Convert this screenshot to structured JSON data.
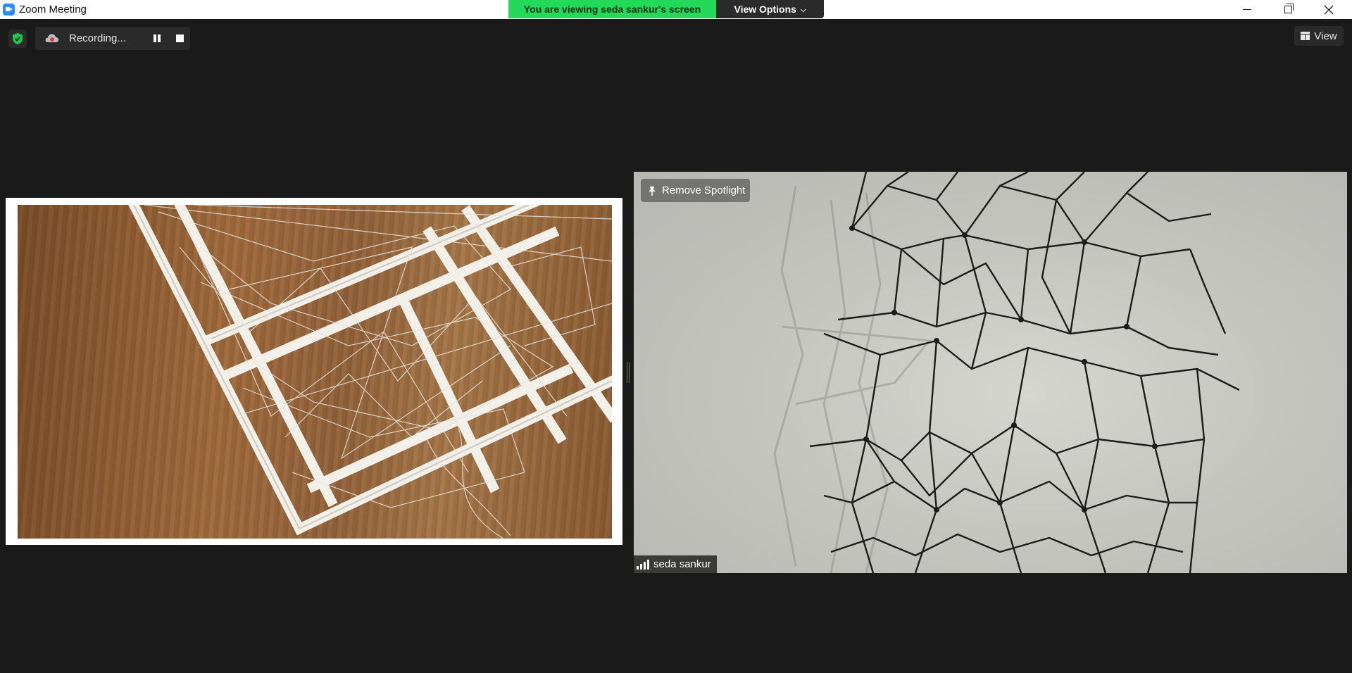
{
  "window": {
    "title": "Zoom Meeting"
  },
  "share_banner": {
    "viewing_text": "You are viewing seda sankur's screen",
    "view_options_label": "View Options"
  },
  "recording": {
    "status_text": "Recording..."
  },
  "view_button": {
    "label": "View"
  },
  "spotlight": {
    "remove_label": "Remove Spotlight"
  },
  "participant": {
    "name": "seda sankur"
  },
  "colors": {
    "share_green": "#23d959",
    "security_green": "#23c552",
    "background": "#1a1a1a"
  }
}
